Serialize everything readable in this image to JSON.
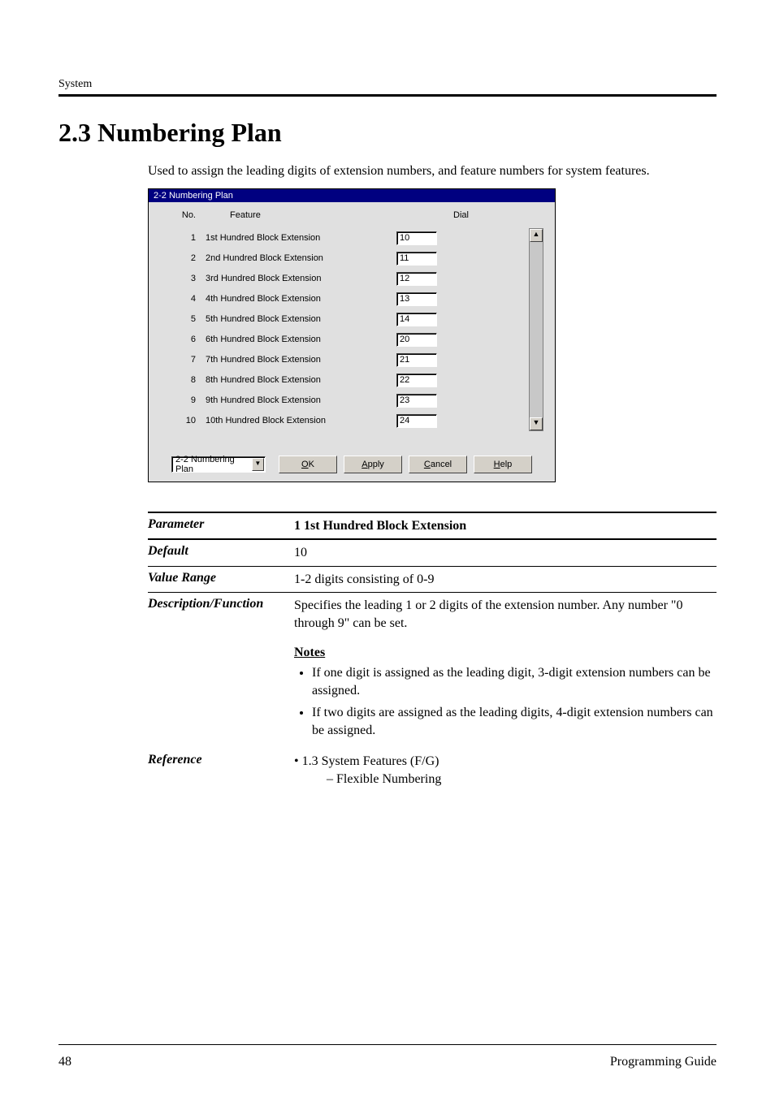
{
  "header": {
    "running": "System",
    "title": "2.3   Numbering Plan",
    "intro": "Used to assign the leading digits of extension numbers, and feature numbers for system features."
  },
  "screenshot": {
    "title": "2-2 Numbering Plan",
    "columns": {
      "no": "No.",
      "feature": "Feature",
      "dial": "Dial"
    },
    "rows": [
      {
        "no": "1",
        "feature": "1st Hundred Block Extension",
        "dial": "10"
      },
      {
        "no": "2",
        "feature": "2nd Hundred Block Extension",
        "dial": "11"
      },
      {
        "no": "3",
        "feature": "3rd Hundred Block Extension",
        "dial": "12"
      },
      {
        "no": "4",
        "feature": "4th Hundred Block Extension",
        "dial": "13"
      },
      {
        "no": "5",
        "feature": "5th Hundred Block Extension",
        "dial": "14"
      },
      {
        "no": "6",
        "feature": "6th Hundred Block Extension",
        "dial": "20"
      },
      {
        "no": "7",
        "feature": "7th Hundred Block Extension",
        "dial": "21"
      },
      {
        "no": "8",
        "feature": "8th Hundred Block Extension",
        "dial": "22"
      },
      {
        "no": "9",
        "feature": "9th Hundred Block Extension",
        "dial": "23"
      },
      {
        "no": "10",
        "feature": "10th Hundred Block Extension",
        "dial": "24"
      }
    ],
    "combo_value": "2-2 Numbering Plan",
    "buttons": {
      "ok": "OK",
      "apply": "Apply",
      "cancel": "Cancel",
      "help": "Help"
    }
  },
  "param": {
    "labels": {
      "parameter": "Parameter",
      "default": "Default",
      "value_range": "Value Range",
      "desc": "Description/Function",
      "reference": "Reference"
    },
    "parameter": "1 1st Hundred Block Extension",
    "default": "10",
    "value_range": "1-2 digits consisting of 0-9",
    "desc": "Specifies the leading 1 or 2 digits of the extension number. Any number \"0 through 9\" can be set.",
    "notes_heading": "Notes",
    "notes": [
      "If one digit is assigned as the leading digit, 3-digit extension numbers can be assigned.",
      "If two digits are assigned as the leading digits, 4-digit extension numbers can be assigned."
    ],
    "reference": {
      "line1": "• 1.3 System Features (F/G)",
      "line2": "– Flexible Numbering"
    }
  },
  "footer": {
    "page": "48",
    "guide": "Programming Guide"
  }
}
